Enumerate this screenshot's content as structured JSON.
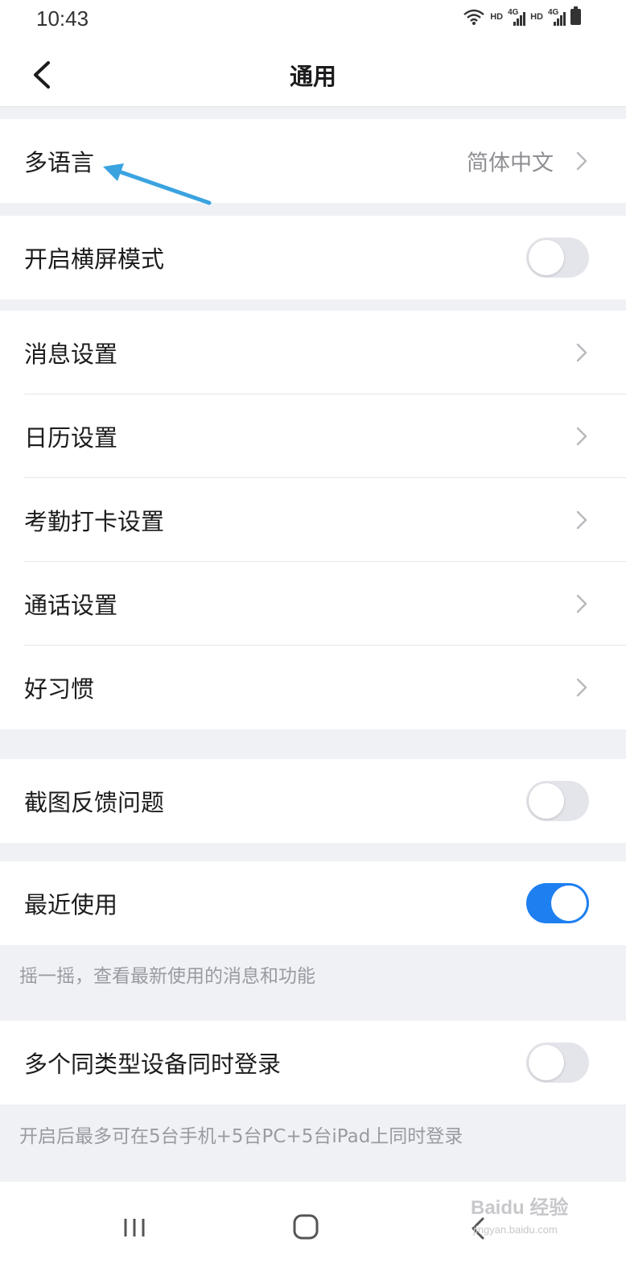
{
  "status_bar": {
    "time": "10:43",
    "hd_1": "HD",
    "net_1": "4G",
    "hd_2": "HD",
    "net_2": "4G"
  },
  "header": {
    "title": "通用"
  },
  "rows": {
    "language": {
      "label": "多语言",
      "value": "简体中文"
    },
    "landscape": {
      "label": "开启横屏模式",
      "enabled": false
    },
    "message_settings": {
      "label": "消息设置"
    },
    "calendar_settings": {
      "label": "日历设置"
    },
    "attendance_settings": {
      "label": "考勤打卡设置"
    },
    "call_settings": {
      "label": "通话设置"
    },
    "good_habits": {
      "label": "好习惯"
    },
    "screenshot_feedback": {
      "label": "截图反馈问题",
      "enabled": false
    },
    "recently_used": {
      "label": "最近使用",
      "enabled": true
    },
    "multi_device_login": {
      "label": "多个同类型设备同时登录",
      "enabled": false
    }
  },
  "hints": {
    "recently_used": "摇一摇，查看最新使用的消息和功能",
    "multi_device_login": "开启后最多可在5台手机+5台PC+5台iPad上同时登录"
  },
  "watermark": {
    "brand": "Baidu 经验",
    "url": "jingyan.baidu.com"
  },
  "colors": {
    "toggle_on": "#1e7ff0",
    "toggle_off": "#e4e5ea",
    "annotation_arrow": "#3aa3e0",
    "page_background": "#f0f1f5"
  }
}
